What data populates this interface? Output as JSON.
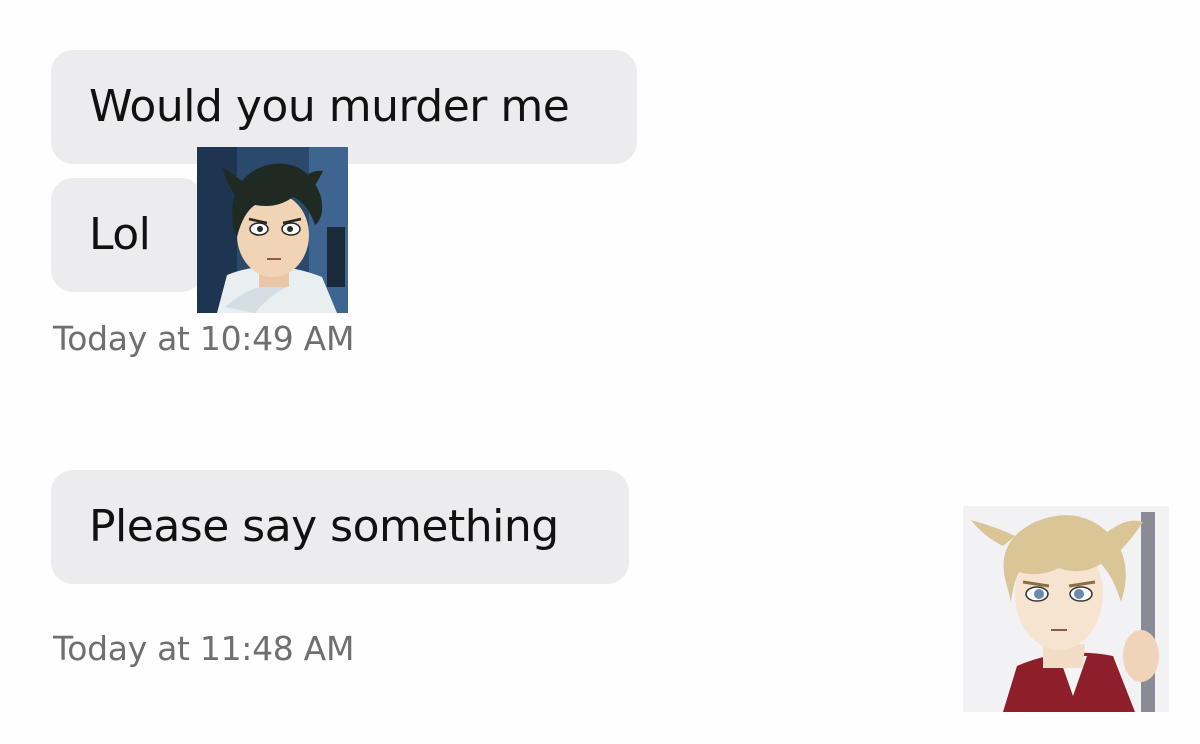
{
  "conversation": {
    "group_1": {
      "messages": [
        {
          "text": "Would you murder me"
        },
        {
          "text": "Lol"
        }
      ],
      "timestamp": "Today at 10:49 AM",
      "avatar": {
        "icon": "anime-boy-dark-hair-avatar",
        "background": "#2b4a6b"
      }
    },
    "group_2": {
      "messages": [
        {
          "text": "Please say something"
        }
      ],
      "timestamp": "Today at 11:48 AM",
      "avatar": {
        "icon": "anime-boy-blonde-hair-avatar",
        "background": "#f2f2f5"
      }
    }
  },
  "colors": {
    "page_background": "#fefefe",
    "bubble_background": "#ececee",
    "message_text": "#111111",
    "timestamp_text": "#6f6f72"
  }
}
